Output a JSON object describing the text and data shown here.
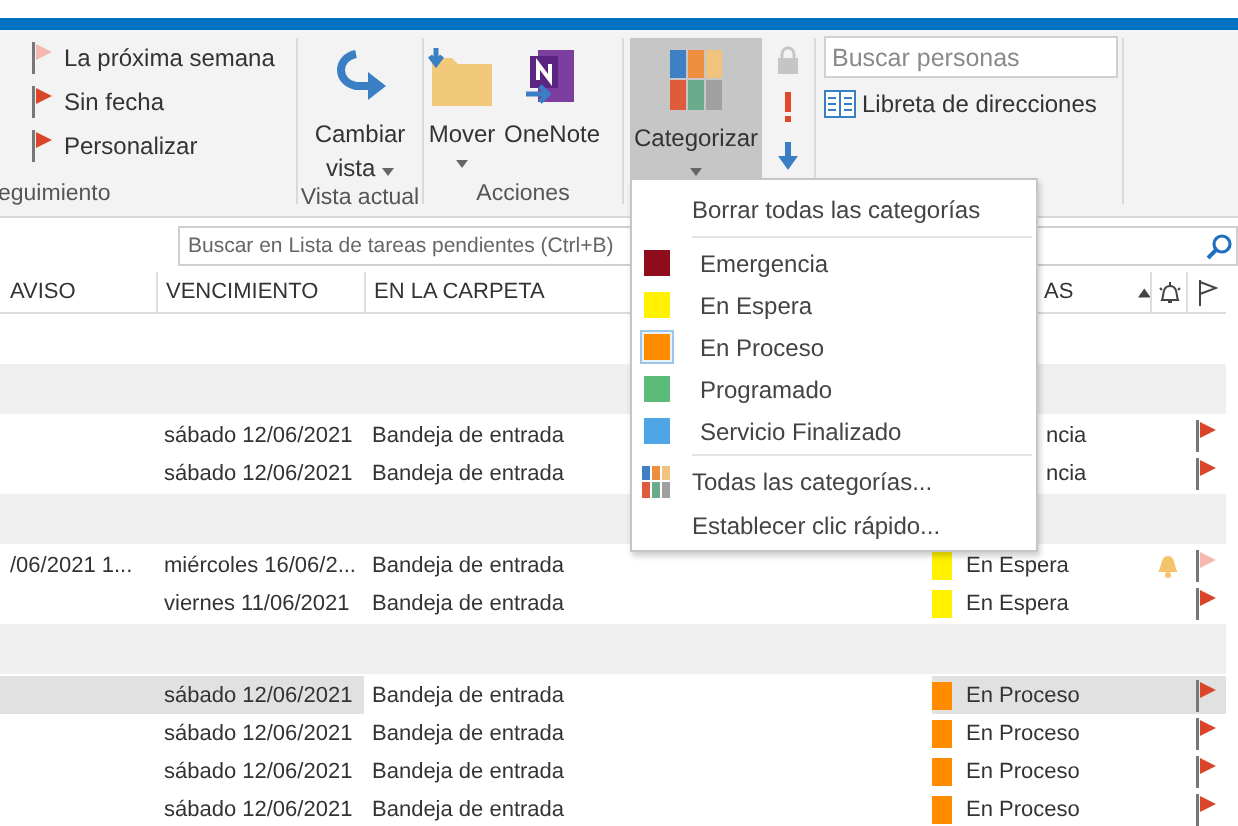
{
  "ribbon": {
    "followup": {
      "items": [
        {
          "label": "La próxima semana",
          "color": "#f6b9b2"
        },
        {
          "label": "Sin fecha",
          "color": "#d9452b"
        },
        {
          "label": "Personalizar",
          "color": "#d9452b"
        }
      ],
      "group_label": "eguimiento"
    },
    "view": {
      "button": "Cambiar vista",
      "group_label": "Vista actual"
    },
    "actions": {
      "move": "Mover",
      "onenote": "OneNote",
      "group_label": "Acciones"
    },
    "tags": {
      "categorize": {
        "label": "Categorizar",
        "selected": true
      },
      "small_buttons": [
        {
          "kind": "lock",
          "disabled": true
        },
        {
          "kind": "high",
          "disabled": false
        },
        {
          "kind": "low",
          "disabled": false
        }
      ]
    },
    "find": {
      "placeholder": "Buscar personas",
      "address_book": "Libreta de direcciones"
    }
  },
  "search": {
    "placeholder": "Buscar en Lista de tareas pendientes (Ctrl+B)"
  },
  "columns": [
    "AVISO",
    "VENCIMIENTO",
    "EN LA CARPETA",
    "AS"
  ],
  "rows": [
    {
      "kind": "blank"
    },
    {
      "kind": "group"
    },
    {
      "kind": "task",
      "reminder_time": "",
      "due": "sábado 12/06/2021",
      "folder": "Bandeja de entrada",
      "category": {
        "label": "ncia"
      },
      "reminder": false,
      "flag": {
        "color": "#d9452b"
      },
      "selected": false
    },
    {
      "kind": "task",
      "reminder_time": "",
      "due": "sábado 12/06/2021",
      "folder": "Bandeja de entrada",
      "category": {
        "label": "ncia"
      },
      "reminder": false,
      "flag": {
        "color": "#d9452b"
      },
      "selected": false
    },
    {
      "kind": "group"
    },
    {
      "kind": "task",
      "reminder_time": "/06/2021 1...",
      "due": "miércoles 16/06/2...",
      "folder": "Bandeja de entrada",
      "category": {
        "label": "En Espera",
        "color": "#fff100"
      },
      "reminder": true,
      "flag": {
        "color": "#f6b9b2"
      },
      "selected": false
    },
    {
      "kind": "task",
      "reminder_time": "",
      "due": "viernes 11/06/2021",
      "folder": "Bandeja de entrada",
      "category": {
        "label": "En Espera",
        "color": "#fff100"
      },
      "reminder": false,
      "flag": {
        "color": "#d9452b"
      },
      "selected": false
    },
    {
      "kind": "group"
    },
    {
      "kind": "task",
      "reminder_time": "",
      "due": "sábado 12/06/2021",
      "folder": "Bandeja de entrada",
      "category": {
        "label": "En Proceso",
        "color": "#ff8c00"
      },
      "reminder": false,
      "flag": {
        "color": "#d9452b"
      },
      "selected": true
    },
    {
      "kind": "task",
      "reminder_time": "",
      "due": "sábado 12/06/2021",
      "folder": "Bandeja de entrada",
      "category": {
        "label": "En Proceso",
        "color": "#ff8c00"
      },
      "reminder": false,
      "flag": {
        "color": "#d9452b"
      },
      "selected": false
    },
    {
      "kind": "task",
      "reminder_time": "",
      "due": "sábado 12/06/2021",
      "folder": "Bandeja de entrada",
      "category": {
        "label": "En Proceso",
        "color": "#ff8c00"
      },
      "reminder": false,
      "flag": {
        "color": "#d9452b"
      },
      "selected": false
    },
    {
      "kind": "task",
      "reminder_time": "",
      "due": "sábado 12/06/2021",
      "folder": "Bandeja de entrada",
      "category": {
        "label": "En Proceso",
        "color": "#ff8c00"
      },
      "reminder": false,
      "flag": {
        "color": "#d9452b"
      },
      "selected": false
    }
  ],
  "menu": {
    "items": [
      {
        "kind": "action",
        "label": "Borrar todas las categorías"
      },
      {
        "kind": "separator"
      },
      {
        "kind": "category",
        "label": "Emergencia",
        "color": "#8e0c1b",
        "checked": false
      },
      {
        "kind": "category",
        "label": "En Espera",
        "color": "#fff100",
        "checked": false
      },
      {
        "kind": "category",
        "label": "En Proceso",
        "color": "#ff8c00",
        "checked": true
      },
      {
        "kind": "category",
        "label": "Programado",
        "color": "#5cbb79",
        "checked": false
      },
      {
        "kind": "category",
        "label": "Servicio Finalizado",
        "color": "#4ea6e6",
        "checked": false
      },
      {
        "kind": "separator"
      },
      {
        "kind": "all",
        "label": "Todas las categorías..."
      },
      {
        "kind": "action",
        "label": "Establecer clic rápido..."
      }
    ]
  }
}
